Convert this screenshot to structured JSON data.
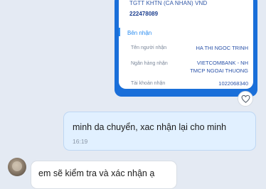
{
  "receipt": {
    "account_name": "TGTT KHTN (CA NHAN) VND",
    "account_number": "222478089",
    "section_title": "Bên nhận",
    "rows": [
      {
        "label": "Tên người nhận",
        "value": "HA THI NGOC TRINH"
      },
      {
        "label": "Ngân hàng nhận",
        "value_line1": "VIETCOMBANK - NH",
        "value_line2": "TMCP NGOAI THUONG"
      },
      {
        "label": "Tài khoản nhận",
        "value": "1022068340"
      }
    ]
  },
  "reaction": {
    "icon": "heart-icon"
  },
  "messages": [
    {
      "direction": "outgoing",
      "text": "minh da chuyển, xac nhận lại cho minh",
      "time": "16:19"
    },
    {
      "direction": "incoming",
      "text": "em sẽ kiểm tra và xác nhận ạ"
    }
  ],
  "colors": {
    "receipt_frame": "#1a6fd9",
    "outgoing_bubble": "#e1f0ff",
    "incoming_bubble": "#ffffff",
    "chat_background": "#e4eaf3"
  }
}
